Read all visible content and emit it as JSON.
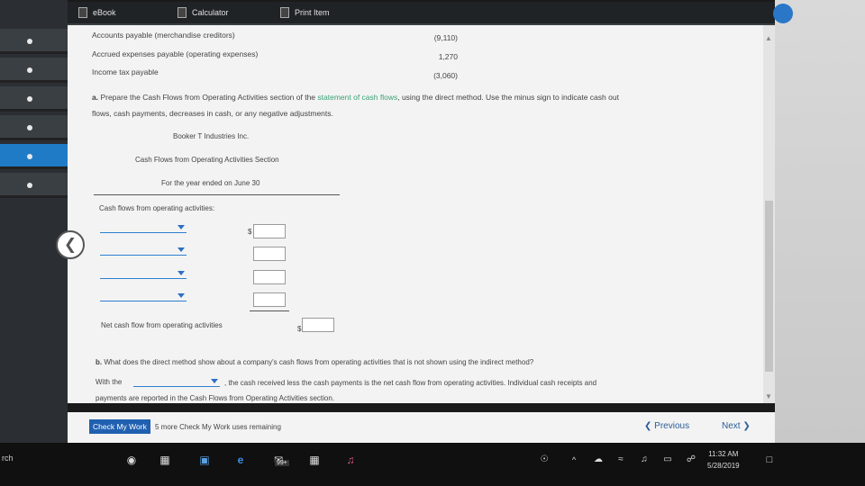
{
  "toolbar": {
    "ebook": "eBook",
    "calculator": "Calculator",
    "print": "Print Item"
  },
  "accounts": [
    {
      "label": "Accounts payable (merchandise creditors)",
      "value": "(9,110)"
    },
    {
      "label": "Accrued expenses payable (operating expenses)",
      "value": "1,270"
    },
    {
      "label": "Income tax payable",
      "value": "(3,060)"
    }
  ],
  "part_a": {
    "prefix": "a.",
    "text_before": " Prepare the Cash Flows from Operating Activities section of the ",
    "link": "statement of cash flows",
    "text_after": ", using the direct method. Use the minus sign to indicate cash out",
    "line2": "flows, cash payments, decreases in cash, or any negative adjustments."
  },
  "statement": {
    "company": "Booker T Industries Inc.",
    "title": "Cash Flows from Operating Activities Section",
    "period": "For the year ended on June 30",
    "section_label": "Cash flows from operating activities:",
    "dollar": "$",
    "net_label": "Net cash flow from operating activities",
    "net_dollar": "$"
  },
  "part_b": {
    "prefix": "b.",
    "question": " What does the direct method show about a company's cash flows from operating activities that is not shown using the indirect method?",
    "with_the": "With the",
    "answer_tail": ", the cash received less the cash payments is the net cash flow from operating activities. Individual cash receipts and",
    "line3": "payments are reported in the Cash Flows from Operating Activities section."
  },
  "footer": {
    "check_button": "Check My Work",
    "remaining": "5 more Check My Work uses remaining",
    "previous": "Previous",
    "next": "Next"
  },
  "taskbar": {
    "search_fragment": "rch",
    "badge": "99+",
    "time": "11:32 AM",
    "date": "5/28/2019"
  },
  "colors": {
    "accent": "#1f7bc6",
    "button": "#2060b0",
    "link": "#3aa37a"
  }
}
